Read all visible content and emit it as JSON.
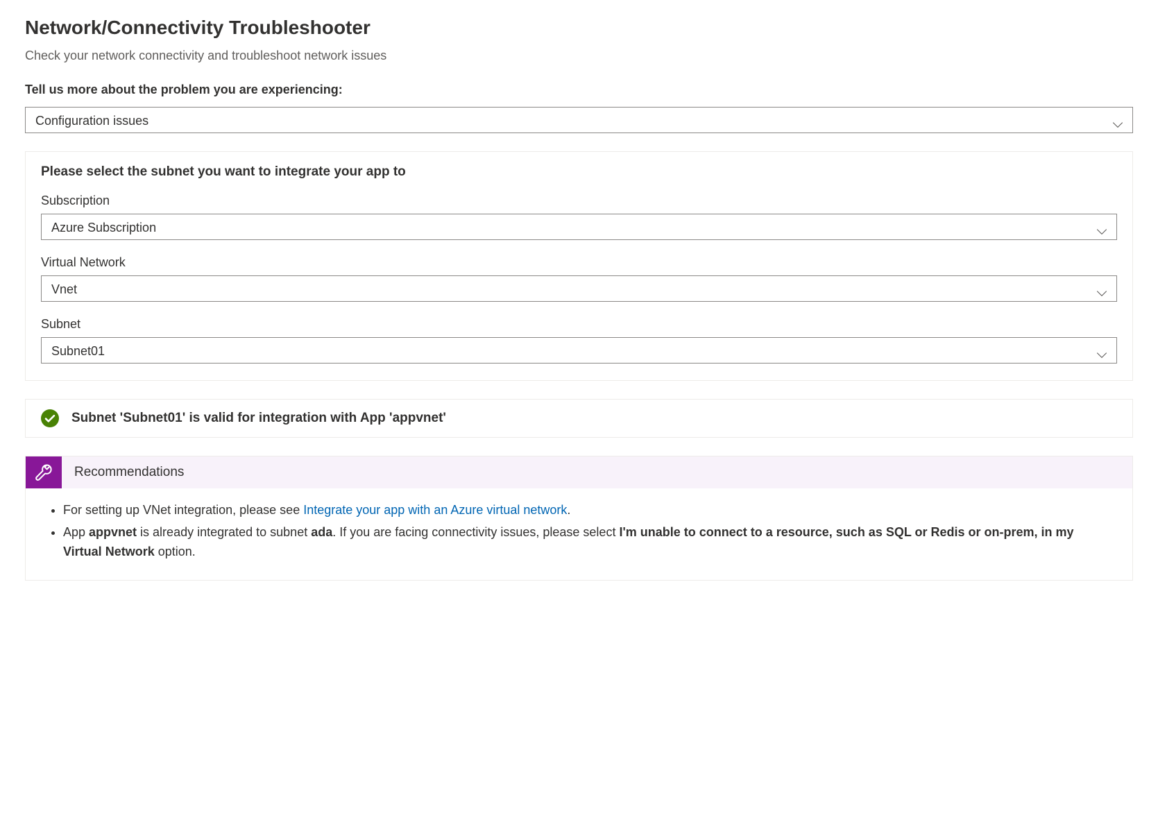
{
  "title": "Network/Connectivity Troubleshooter",
  "subtitle": "Check your network connectivity and troubleshoot network issues",
  "prompt": "Tell us more about the problem you are experiencing:",
  "problem_select": "Configuration issues",
  "subnet_card": {
    "heading": "Please select the subnet you want to integrate your app to",
    "subscription_label": "Subscription",
    "subscription_value": "Azure Subscription",
    "vnet_label": "Virtual Network",
    "vnet_value": "Vnet",
    "subnet_label": "Subnet",
    "subnet_value": "Subnet01"
  },
  "status": {
    "prefix": "Subnet ",
    "subnet_name": "'Subnet01'",
    "middle": " is valid for integration with App ",
    "app_name": "'appvnet'"
  },
  "recommendations": {
    "title": "Recommendations",
    "item1_prefix": "For setting up VNet integration, please see ",
    "item1_link": "Integrate your app with an Azure virtual network",
    "item1_suffix": ".",
    "item2_p1": "App ",
    "item2_app": "appvnet",
    "item2_p2": " is already integrated to subnet ",
    "item2_subnet": "ada",
    "item2_p3": ". If you are facing connectivity issues, please select ",
    "item2_bold": "I'm unable to connect to a resource, such as SQL or Redis or on-prem, in my Virtual Network",
    "item2_p4": " option."
  }
}
